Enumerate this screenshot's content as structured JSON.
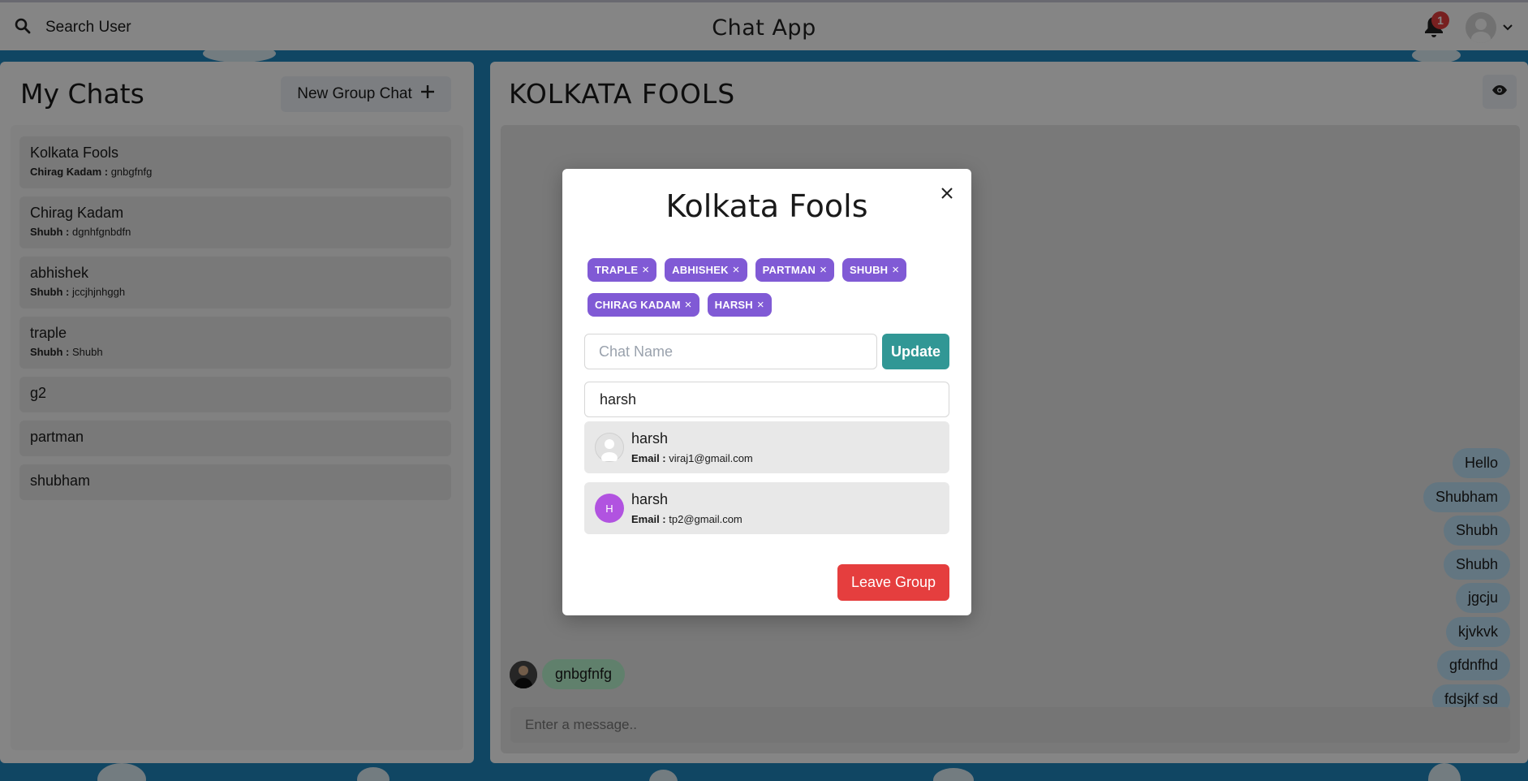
{
  "header": {
    "search_label": "Search User",
    "app_title": "Chat App",
    "notification_count": "1"
  },
  "sidebar": {
    "title": "My Chats",
    "new_group_label": "New Group Chat",
    "chats": [
      {
        "name": "Kolkata Fools",
        "sender": "Chirag Kadam :",
        "message": "gnbgfnfg"
      },
      {
        "name": "Chirag Kadam",
        "sender": "Shubh :",
        "message": "dgnhfgnbdfn"
      },
      {
        "name": "abhishek",
        "sender": "Shubh :",
        "message": "jccjhjnhggh"
      },
      {
        "name": "traple",
        "sender": "Shubh :",
        "message": "Shubh"
      },
      {
        "name": "g2"
      },
      {
        "name": "partman"
      },
      {
        "name": "shubham"
      }
    ]
  },
  "chat": {
    "title": "KOLKATA FOOLS",
    "outgoing_messages": [
      "Hello",
      "Shubham",
      "Shubh",
      "Shubh",
      "jgcju",
      "kjvkvk",
      "gfdnfhd",
      "fdsjkf sd"
    ],
    "incoming_message": "gnbgfnfg",
    "input_placeholder": "Enter a message.."
  },
  "modal": {
    "title": "Kolkata Fools",
    "members": [
      "TRAPLE",
      "ABHISHEK",
      "PARTMAN",
      "SHUBH",
      "CHIRAG KADAM",
      "HARSH"
    ],
    "chat_name_placeholder": "Chat Name",
    "update_label": "Update",
    "search_value": "harsh",
    "results": [
      {
        "name": "harsh",
        "email_label": "Email :",
        "email": "viraj1@gmail.com",
        "avatar": "default-user"
      },
      {
        "name": "harsh",
        "email_label": "Email :",
        "email": "tp2@gmail.com",
        "avatar_initial": "H"
      }
    ],
    "leave_label": "Leave Group"
  },
  "colors": {
    "accent_purple": "#805ad5",
    "update_teal": "#319795",
    "leave_red": "#e53e3e",
    "outgoing_bubble": "#bee3f8",
    "incoming_bubble": "#b9f5d0"
  }
}
